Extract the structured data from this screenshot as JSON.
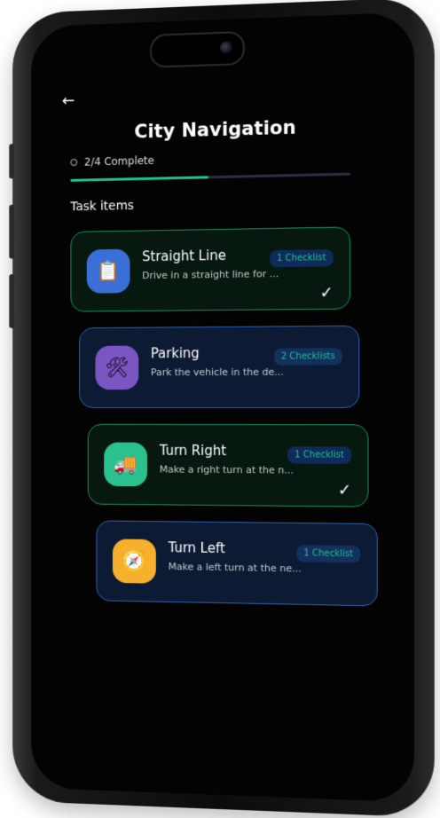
{
  "header": {
    "back_icon": "←",
    "title": "City Navigation"
  },
  "progress": {
    "text": "2/4 Complete",
    "value_fraction": 0.5
  },
  "section": {
    "title": "Task items"
  },
  "tasks": [
    {
      "title": "Straight Line",
      "description": "Drive in a straight line for ...",
      "badge": "1 Checklist",
      "completed": true,
      "icon": "clipboard",
      "icon_glyph": "📋",
      "icon_color": "#3b6fd8",
      "check_glyph": "✓"
    },
    {
      "title": "Parking",
      "description": "Park the vehicle in the de...",
      "badge": "2 Checklists",
      "completed": false,
      "icon": "tools",
      "icon_glyph": "🛠",
      "icon_color": "#7b55c2"
    },
    {
      "title": "Turn Right",
      "description": "Make a right turn at the n...",
      "badge": "1 Checklist",
      "completed": true,
      "icon": "truck",
      "icon_glyph": "🚚",
      "icon_color": "#2bc18f",
      "check_glyph": "✓"
    },
    {
      "title": "Turn Left",
      "description": "Make a left turn at the ne...",
      "badge": "1 Checklist",
      "completed": false,
      "icon": "compass",
      "icon_glyph": "🧭",
      "icon_color": "#f6b02d"
    }
  ],
  "colors": {
    "accent_green": "#1cc38d",
    "card_green_border": "#1a8e5c",
    "card_blue_border": "#2e5fae"
  }
}
